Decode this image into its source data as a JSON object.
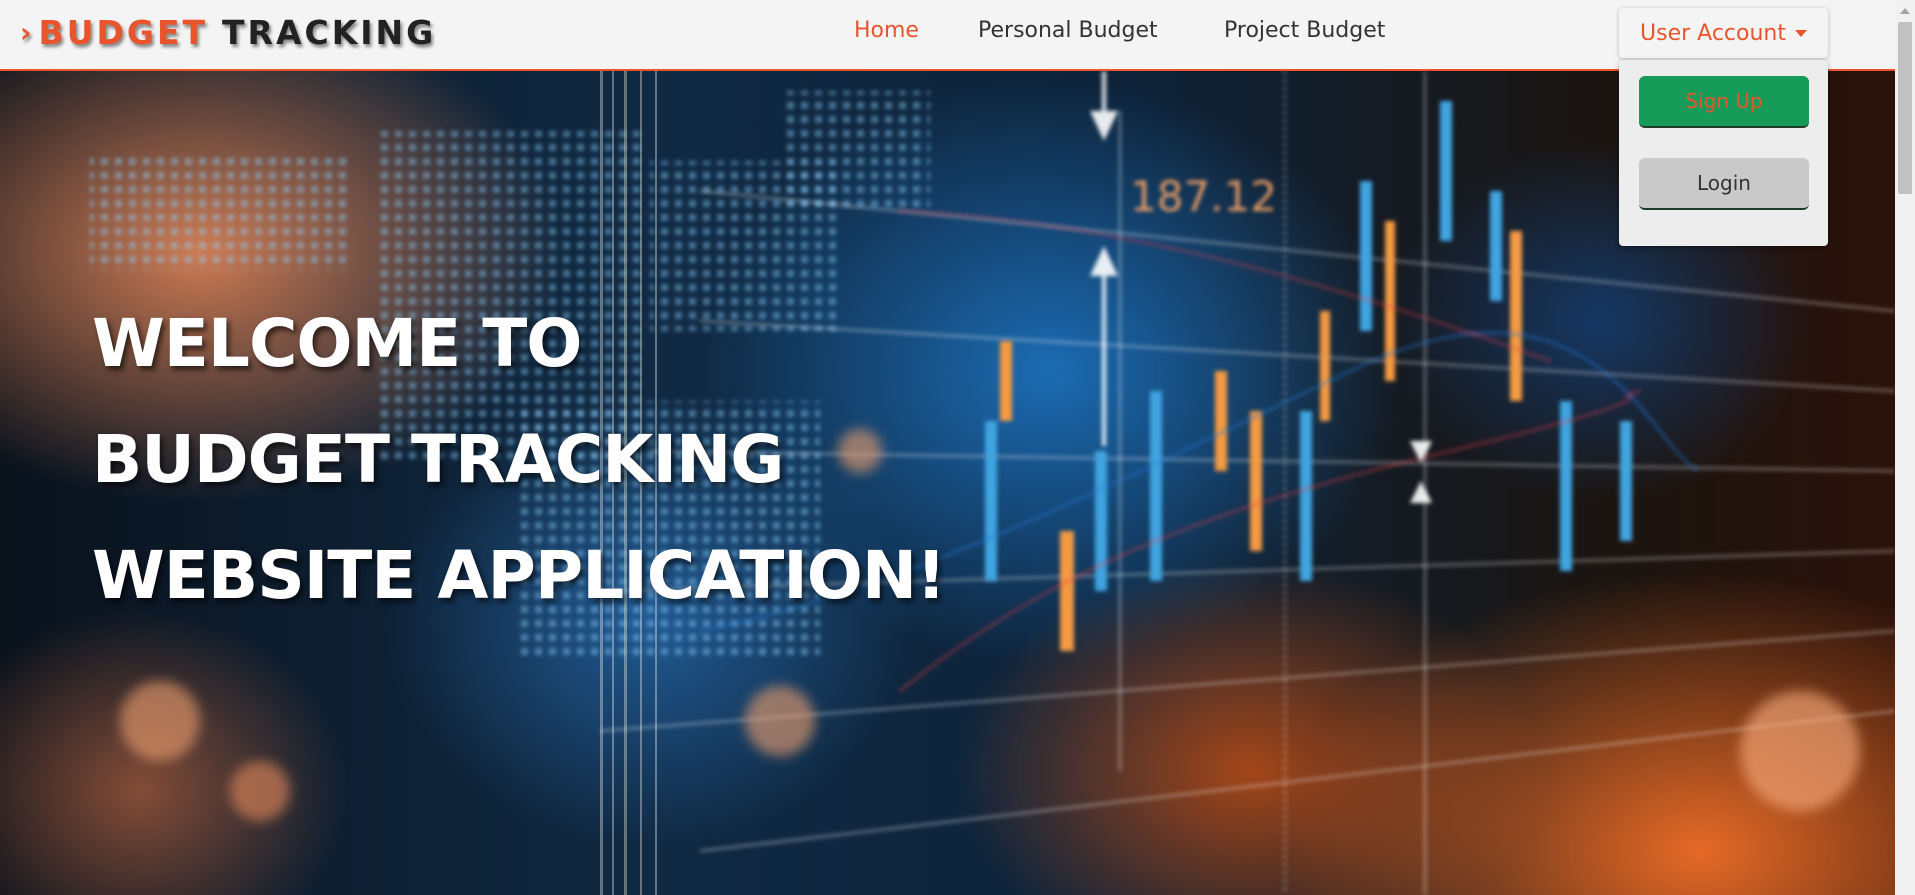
{
  "brand": {
    "part1": "BUDGET",
    "part2": "TRACKING",
    "chevron": "›"
  },
  "nav": {
    "items": [
      {
        "label": "Home",
        "active": true
      },
      {
        "label": "Personal Budget",
        "active": false
      },
      {
        "label": "Project Budget",
        "active": false
      }
    ],
    "account": {
      "label": "User Account",
      "icon": "caret-down-icon"
    }
  },
  "dropdown": {
    "signup_label": "Sign Up",
    "login_label": "Login"
  },
  "hero": {
    "lines": [
      "WELCOME TO",
      "BUDGET TRACKING",
      "WEBSITE APPLICATION!"
    ],
    "chart_label": "187.12"
  },
  "colors": {
    "accent": "#e8552c",
    "signup_bg": "#169c58",
    "login_bg": "#c9c9c9",
    "navbar_bg": "#f4f4f4",
    "text_dark": "#333333"
  }
}
